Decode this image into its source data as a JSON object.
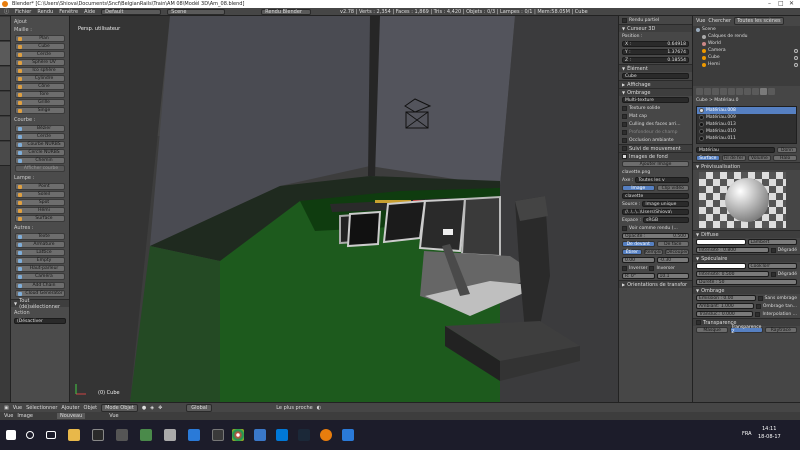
{
  "window": {
    "title": "Blender* [C:\\Users\\Shiova\\Documents\\Sncf\\BelgianRails\\Train\\AM 08\\Modèl 3D\\Am_08.blend]"
  },
  "menubar": {
    "items": [
      "Fichier",
      "Rendu",
      "Fenêtre",
      "Aide"
    ],
    "layout": "Default",
    "scene": "Scene",
    "engine": "Rendu Blender",
    "stats": "v2.78 | Verts : 2,354 | Faces : 1,869 | Tris : 4,420 | Objets : 0/3 | Lampes : 0/1 | Mem:58.05M | Cube"
  },
  "toolshelf": {
    "add_header": "Ajout",
    "mesh_label": "Maille :",
    "mesh_items": [
      "Plan",
      "Cube",
      "Cercle",
      "Sphère UV",
      "Ico sphère",
      "Cylindre",
      "Cône",
      "Tore",
      "Grille",
      "Singe"
    ],
    "curve_label": "Courbe :",
    "curve_items": [
      "Bézier",
      "Cercle",
      "Courbe NURBS",
      "Cercle NURBS",
      "Chemin"
    ],
    "extra_btn": "Afficher courbe",
    "lamp_label": "Lampe :",
    "lamp_items": [
      "Point",
      "Soleil",
      "Spot",
      "Hémi",
      "Surface"
    ],
    "other_label": "Autres :",
    "other_items": [
      "Texte",
      "Armature",
      "Lattice",
      "Empty",
      "Haut-parleur",
      "Caméra"
    ],
    "bottom_items": [
      "Add Chain",
      "Cloud Generator"
    ],
    "op_header": "Tout (dé)sélectionner",
    "action_label": "Action",
    "action_value": "(Désactiver"
  },
  "viewport": {
    "view_label": "Persp. utilisateur",
    "object_label": "(0) Cube"
  },
  "props3d": {
    "render_partial": "Rendu partiel",
    "cursor_header": "Curseur 3D",
    "position_label": "Position :",
    "x_label": "X :",
    "x_value": "0.64918",
    "y_label": "Y :",
    "y_value": "1.37674",
    "z_label": "Z :",
    "z_value": "0.18554",
    "element_header": "Élément",
    "element_value": "Cube",
    "display_header": "Affichage",
    "shading_header": "Ombrage",
    "shading_value": "Multi-texture",
    "shading_opts": [
      "Texture solide",
      "Mat cap",
      "Culling des faces arri...",
      "Profondeur de champ",
      "Occlusion ambiante"
    ],
    "motion_header": "Suivi de mouvement",
    "bg_header": "Images de fond",
    "add_image": "Ajouter Image",
    "image_name": "clavette.png",
    "axis_label": "Axe :",
    "axis_value": "Toutes les v",
    "tab_image": "Image",
    "tab_clip": "Clip vidéo",
    "image_file": "clavette",
    "source_label": "Source :",
    "source_value": "Image unique",
    "path_value": "//..\\..\\..\\Users\\Shiova\\",
    "space_label": "Espace :",
    "space_value": "sRGB",
    "view_as": "Voir comme rendu (...",
    "opacity_label": "Opacité :",
    "opacity_value": "0.500",
    "front_btn": "De devant",
    "back_btn": "De face",
    "fill_btns": [
      "Étirer",
      "Remplir",
      "Découper"
    ],
    "x_off": "0.00",
    "y_off": "-0.30",
    "flip_x": "Inverser",
    "flip_y": "Inverser",
    "rot_value": "R: 0°",
    "size_value": "10.1",
    "transform_header": "Orientations de transfor"
  },
  "outliner": {
    "tabs": [
      "Vue",
      "Chercher",
      "Toutes les scènes"
    ],
    "items": [
      "Scene",
      "Calques de rendu",
      "World",
      "Camera",
      "Cube",
      "Hemi"
    ]
  },
  "matpanel": {
    "breadcrumb": "Cube > Matériau.0",
    "materials": [
      "Matériau.008",
      "Matériau.009",
      "Matériau.013",
      "Matériau.010",
      "Matériau.011"
    ],
    "mat_name": "Matériau",
    "data_btn": "Donn",
    "tabs": [
      "Surface",
      "Fil de fer",
      "Volume",
      "Halo"
    ],
    "preview_header": "Prévisualisation",
    "diffuse_header": "Diffuse",
    "diffuse_shader": "Lambert",
    "intensity_label": "Intensité : 0.800",
    "ramp": "Dégradé",
    "specular_header": "Spéculaire",
    "spec_shader": "CookTorr",
    "spec_intensity": "Intensité: 0.500",
    "spec_ramp": "Dégradé",
    "hardness": "Dureté : 50",
    "shading_header": "Ombrage",
    "emit": "Émission : 0.00",
    "ambient": "Ambiant: 1.000",
    "translucency": "Transluc.: 0.000",
    "shadeless": "Sans ombrage",
    "tangent": "Ombrage tan...",
    "cubic": "Interpolation ...",
    "transp_header": "Transparence",
    "transp_tabs": [
      "Masque",
      "Transparence Z",
      "Raytrace"
    ]
  },
  "statusbar": {
    "items": [
      "Vue",
      "Sélectionner",
      "Ajouter",
      "Objet"
    ],
    "mode": "Mode Objet",
    "pivot": "Global",
    "snap": "Le plus proche"
  },
  "timeline": {
    "items": [
      "Vue",
      "Image",
      "Nouveau",
      "Vue"
    ]
  },
  "taskbar": {
    "lang": "FRA",
    "time": "14:11",
    "date": "18-08-17"
  },
  "colors": {
    "accent": "#5680c2",
    "panel": "#464646",
    "viewport": "#3d3d3d",
    "green": "#1d5a1d",
    "blender_orange": "#e87d0d"
  }
}
